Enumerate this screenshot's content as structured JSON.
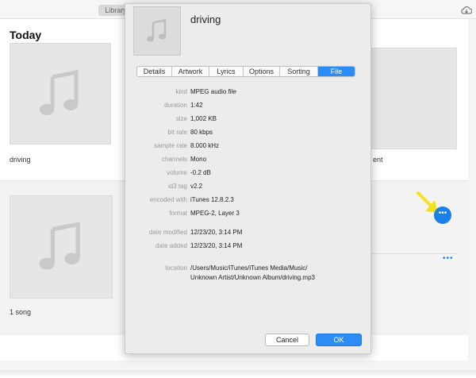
{
  "background": {
    "library_label": "Library",
    "today_title": "Today",
    "album_label": "driving",
    "right_album_label": "ent",
    "song_count": "1 song",
    "more_dots": "•••"
  },
  "dialog": {
    "title": "driving",
    "tabs": [
      "Details",
      "Artwork",
      "Lyrics",
      "Options",
      "Sorting",
      "File"
    ],
    "active_tab": "File",
    "rows": [
      {
        "label": "kind",
        "value": "MPEG audio file"
      },
      {
        "label": "duration",
        "value": "1:42"
      },
      {
        "label": "size",
        "value": "1,002 KB"
      },
      {
        "label": "bit rate",
        "value": "80 kbps"
      },
      {
        "label": "sample rate",
        "value": "8.000 kHz"
      },
      {
        "label": "channels",
        "value": "Mono"
      },
      {
        "label": "volume",
        "value": "-0.2 dB"
      },
      {
        "label": "id3 tag",
        "value": "v2.2"
      },
      {
        "label": "encoded with",
        "value": "iTunes 12.8.2.3"
      },
      {
        "label": "format",
        "value": "MPEG-2, Layer 3"
      },
      {
        "label": "date modified",
        "value": "12/23/20, 3:14 PM"
      },
      {
        "label": "date added",
        "value": "12/23/20, 3:14 PM"
      }
    ],
    "location_label": "location",
    "location_line1": "/Users/Music/iTunes/iTunes Media/Music/",
    "location_line2": "Unknown Artist/Unknown Album/driving.mp3",
    "cancel_label": "Cancel",
    "ok_label": "OK"
  },
  "colors": {
    "accent": "#2a8cf4",
    "arrow": "#f2e21c"
  }
}
